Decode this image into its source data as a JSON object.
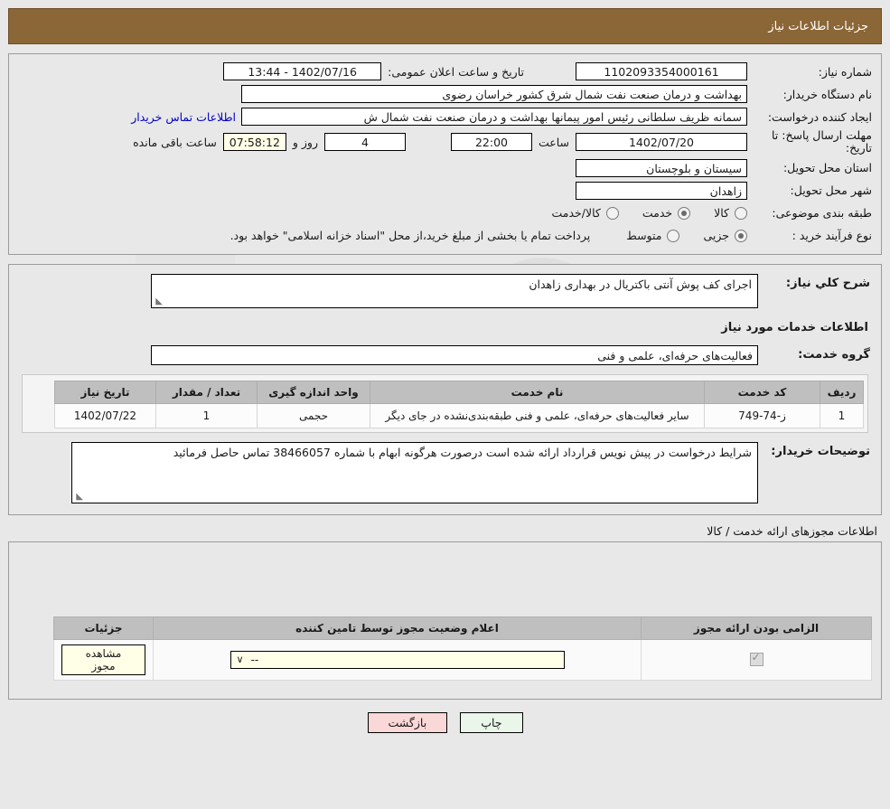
{
  "header": {
    "title": "جزئیات اطلاعات نیاز"
  },
  "info": {
    "need_number_label": "شماره نیاز:",
    "need_number": "1102093354000161",
    "announce_label": "تاریخ و ساعت اعلان عمومی:",
    "announce_value": "1402/07/16 - 13:44",
    "buyer_org_label": "نام دستگاه خریدار:",
    "buyer_org": "بهداشت و درمان صنعت نفت شمال شرق کشور   خراسان رضوی",
    "creator_label": "ایجاد کننده درخواست:",
    "creator": "سمانه ظریف سلطانی رئیس امور پیمانها بهداشت و درمان صنعت نفت شمال ش",
    "contact_link": "اطلاعات تماس خریدار",
    "deadline_label": "مهلت ارسال پاسخ: تا تاریخ:",
    "deadline_date": "1402/07/20",
    "hour_label": "ساعت",
    "deadline_time": "22:00",
    "days_value": "4",
    "days_label": "روز و",
    "remaining_time": "07:58:12",
    "remaining_label": "ساعت باقی مانده",
    "province_label": "استان محل تحویل:",
    "province": "سیستان و بلوچستان",
    "city_label": "شهر محل تحویل:",
    "city": "زاهدان",
    "category_label": "طبقه بندی موضوعی:",
    "category_options": [
      {
        "label": "کالا",
        "selected": false
      },
      {
        "label": "خدمت",
        "selected": true
      },
      {
        "label": "کالا/خدمت",
        "selected": false
      }
    ],
    "process_label": "نوع فرآیند خرید :",
    "process_options": [
      {
        "label": "جزیی",
        "selected": true
      },
      {
        "label": "متوسط",
        "selected": false
      }
    ],
    "process_note": "پرداخت تمام یا بخشی از مبلغ خرید،از محل \"اسناد خزانه اسلامی\" خواهد بود."
  },
  "need": {
    "summary_label": "شرح کلي نیاز:",
    "summary_value": "اجرای کف پوش آنتی باکتریال در بهداری زاهدان",
    "services_head": "اطلاعات خدمات مورد نیاز",
    "service_group_label": "گروه خدمت:",
    "service_group_value": "فعالیت‌های حرفه‌ای، علمی و فنی"
  },
  "table": {
    "columns": [
      "ردیف",
      "کد خدمت",
      "نام خدمت",
      "واحد اندازه گیری",
      "تعداد / مقدار",
      "تاریخ نیاز"
    ],
    "rows": [
      {
        "row": "1",
        "code": "ز-74-749",
        "name": "سایر فعالیت‌های حرفه‌ای، علمی و فنی طبقه‌بندی‌نشده در جای دیگر",
        "unit": "حجمی",
        "qty": "1",
        "date": "1402/07/22"
      }
    ]
  },
  "buyer_notes": {
    "label": "توضیحات خریدار:",
    "value": "شرایط درخواست در پیش نویس قرارداد ارائه شده است درصورت هرگونه ابهام با شماره 38466057 تماس حاصل فرمائید"
  },
  "permits": {
    "caption": "اطلاعات مجوزهای ارائه خدمت / کالا",
    "columns": [
      "الزامی بودن ارائه مجوز",
      "اعلام وضعیت مجوز توسط تامین کننده",
      "جزئیات"
    ],
    "rows": [
      {
        "required": true,
        "status_value": "--",
        "details_button": "مشاهده مجوز"
      }
    ]
  },
  "footer": {
    "print_label": "چاپ",
    "back_label": "بازگشت"
  },
  "watermark": {
    "text": "AriaTender.net"
  },
  "colors": {
    "title_bar": "#8b6636",
    "link": "#0000cc",
    "header_row": "#bfbfbf",
    "print_button": "#eaf6ea",
    "back_button": "#fbd8d8",
    "field_yellow": "#ffffe8"
  }
}
